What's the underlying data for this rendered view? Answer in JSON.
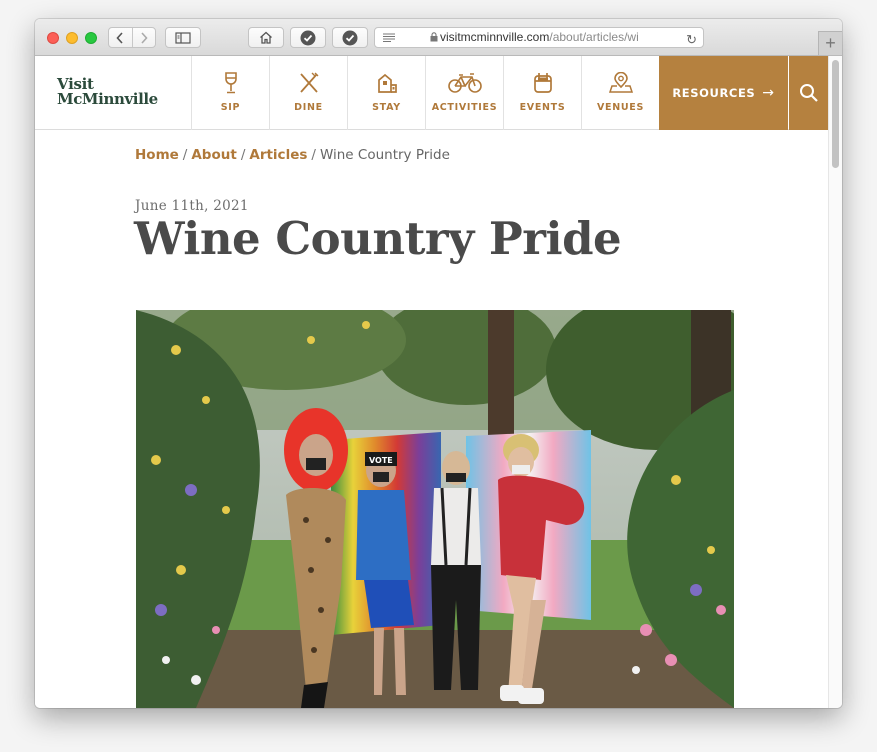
{
  "browser": {
    "url_domain": "visitmcminnville.com",
    "url_path": "/about/articles/wi",
    "new_tab_label": "+"
  },
  "site": {
    "logo_line1": "Visit",
    "logo_line2": "McMinnville",
    "nav": [
      {
        "label": "SIP",
        "icon": "wine-glass-icon"
      },
      {
        "label": "DINE",
        "icon": "fork-knife-icon"
      },
      {
        "label": "STAY",
        "icon": "house-icon"
      },
      {
        "label": "ACTIVITIES",
        "icon": "bicycle-icon"
      },
      {
        "label": "EVENTS",
        "icon": "calendar-icon"
      },
      {
        "label": "VENUES",
        "icon": "map-pin-icon"
      }
    ],
    "resources_label": "RESOURCES",
    "resources_arrow": "→",
    "accent_color": "#b5813f"
  },
  "breadcrumb": {
    "items": [
      "Home",
      "About",
      "Articles"
    ],
    "separator": "/",
    "current": "Wine Country Pride"
  },
  "article": {
    "date": "June 11th, 2021",
    "title": "Wine Country Pride",
    "hero_sign_text": "VOTE"
  }
}
